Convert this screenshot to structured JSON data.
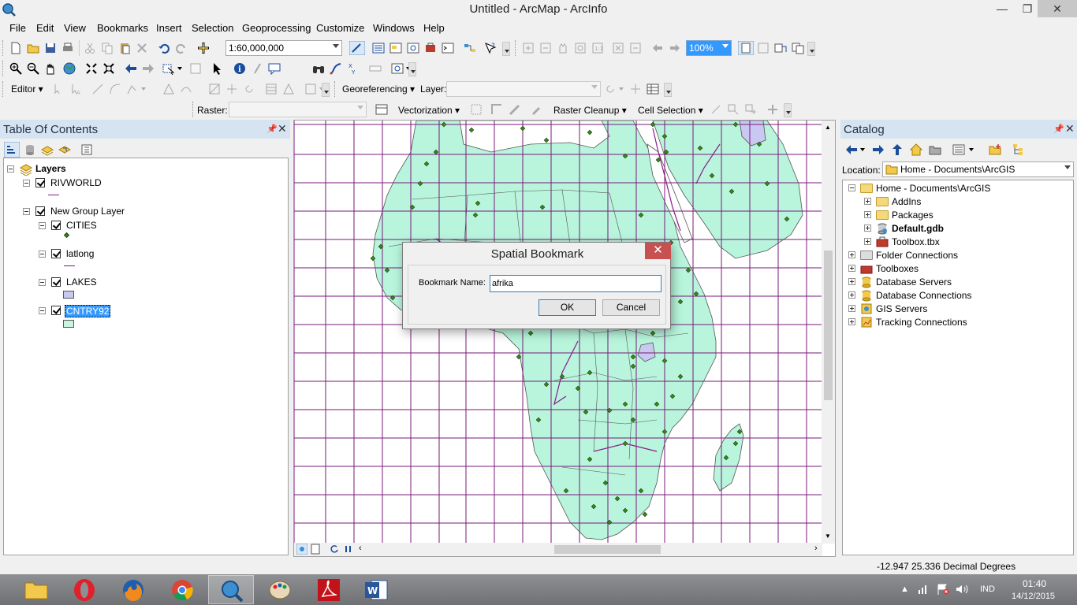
{
  "window": {
    "title": "Untitled - ArcMap - ArcInfo",
    "controls": {
      "minimize": "—",
      "maximize": "❐",
      "close": "✕"
    }
  },
  "menu": [
    "File",
    "Edit",
    "View",
    "Bookmarks",
    "Insert",
    "Selection",
    "Geoprocessing",
    "Customize",
    "Windows",
    "Help"
  ],
  "toolbars": {
    "scale": "1:60,000,000",
    "zoom_percent": "100%",
    "editor_label": "Editor ▾",
    "georeferencing_label": "Georeferencing ▾",
    "layer_label": "Layer:",
    "raster_label": "Raster:",
    "vectorization_label": "Vectorization ▾",
    "raster_cleanup_label": "Raster Cleanup ▾",
    "cell_selection_label": "Cell Selection ▾"
  },
  "toc": {
    "title": "Table Of Contents",
    "layers_root": "Layers",
    "layers": [
      "RIVWORLD",
      "New Group Layer",
      "CITIES",
      "latlong",
      "LAKES",
      "CNTRY92"
    ],
    "colors": {
      "lakes": "#c8c8f0",
      "cntry92": "#c8f5e0",
      "rivworld": "#8b1a8b"
    }
  },
  "catalog": {
    "title": "Catalog",
    "location_label": "Location:",
    "location_value": "Home - Documents\\ArcGIS",
    "items": [
      "Home - Documents\\ArcGIS",
      "AddIns",
      "Packages",
      "Default.gdb",
      "Toolbox.tbx",
      "Folder Connections",
      "Toolboxes",
      "Database Servers",
      "Database Connections",
      "GIS Servers",
      "Tracking Connections"
    ]
  },
  "dialog": {
    "title": "Spatial Bookmark",
    "label": "Bookmark Name:",
    "value": "afrika",
    "ok": "OK",
    "cancel": "Cancel"
  },
  "map": {
    "land_color": "#b8f5dc",
    "grid_color": "#7a1a7a",
    "city_color": "#3a8a1a"
  },
  "status": {
    "coords": "-12.947  25.336 Decimal Degrees"
  },
  "taskbar": {
    "language": "IND",
    "time": "01:40",
    "date": "14/12/2015"
  }
}
